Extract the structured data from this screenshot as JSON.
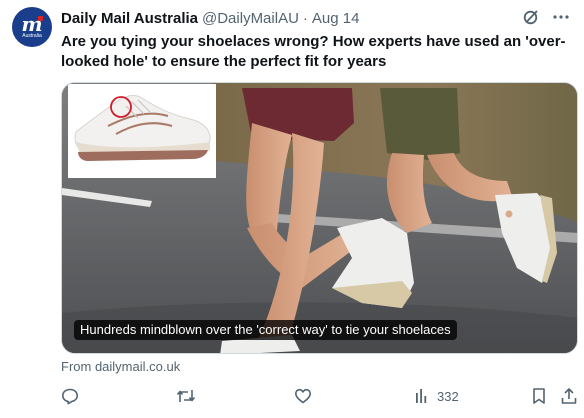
{
  "author": {
    "avatar_text": "m",
    "avatar_subtext": "Australia",
    "display_name": "Daily Mail Australia",
    "handle": "@DailyMailAU",
    "separator": "·",
    "time": "Aug 14"
  },
  "tweet": {
    "text": "Are you tying your shoelaces wrong? How experts have used an 'over-looked hole' to ensure the perfect fit for years"
  },
  "media": {
    "caption": "Hundreds mindblown over the 'correct way' to tie your shoelaces"
  },
  "card": {
    "source": "From dailymail.co.uk"
  },
  "actions": {
    "views_count": "332"
  },
  "icons": [
    "grok-icon",
    "more-icon",
    "reply-icon",
    "retweet-icon",
    "like-icon",
    "views-icon",
    "bookmark-icon",
    "share-icon"
  ],
  "colors": {
    "text": "#0f1419",
    "secondary": "#536471",
    "border": "#cfd9de",
    "avatar_bg": "#1a3e8c"
  }
}
